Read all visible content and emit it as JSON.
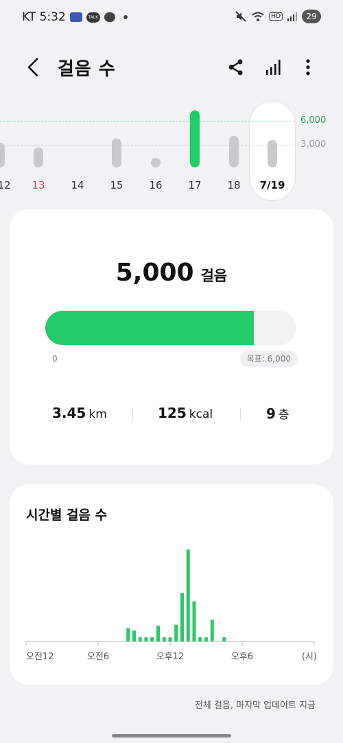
{
  "status_bar": {
    "carrier_time": "KT 5:32",
    "icons": [
      "app-icon",
      "kakao-talk-icon",
      "chat-bubble-icon",
      "dot-icon"
    ],
    "talk_label": "TALK",
    "hd_label": "HD",
    "battery": "29"
  },
  "header": {
    "title": "걸음 수",
    "back_icon": "chevron-left-icon",
    "share_icon": "share-icon",
    "chart_icon": "bar-chart-icon",
    "more_icon": "more-vertical-icon"
  },
  "daily_strip": {
    "goal_label": "6,000",
    "mid_label": "3,000",
    "days": [
      {
        "label": "12",
        "steps": 3000,
        "red": false,
        "selected": false
      },
      {
        "label": "13",
        "steps": 2400,
        "red": true,
        "selected": false
      },
      {
        "label": "14",
        "steps": 0,
        "red": false,
        "selected": false
      },
      {
        "label": "15",
        "steps": 3500,
        "red": false,
        "selected": false
      },
      {
        "label": "16",
        "steps": 1100,
        "red": false,
        "selected": false
      },
      {
        "label": "17",
        "steps": 6900,
        "red": false,
        "selected": false
      },
      {
        "label": "18",
        "steps": 3800,
        "red": false,
        "selected": false
      },
      {
        "label": "7/19",
        "steps": 3300,
        "red": false,
        "selected": true
      }
    ],
    "accent_color": "#23cc67",
    "bar_color": "#c9c9cb",
    "weekend_color": "#d34c3e"
  },
  "summary": {
    "steps": "5,000",
    "steps_unit": "걸음",
    "progress_fraction": 0.83,
    "progress_start": "0",
    "goal_text": "목표: 6,000",
    "distance": "3.45",
    "distance_unit": "km",
    "calories": "125",
    "calories_unit": "kcal",
    "floors": "9",
    "floors_unit": "층"
  },
  "hourly": {
    "title": "시간별 걸음 수",
    "x_tick_labels": [
      "오전12",
      "오전6",
      "오후12",
      "오후6"
    ],
    "x_unit": "(시)"
  },
  "chart_data": {
    "type": "bar",
    "title": "시간별 걸음 수",
    "xlabel": "(시)",
    "ylabel": "",
    "x_tick_labels": [
      "오전12",
      "오전6",
      "오후12",
      "오후6"
    ],
    "x_hours": [
      8.5,
      9.0,
      9.5,
      10.0,
      10.5,
      11.0,
      11.5,
      12.0,
      12.5,
      13.0,
      13.5,
      14.0,
      14.5,
      15.0,
      15.5,
      16.5
    ],
    "values": [
      160,
      130,
      50,
      50,
      50,
      190,
      50,
      50,
      200,
      580,
      1100,
      480,
      50,
      50,
      260,
      50
    ],
    "xlim": [
      0,
      24
    ],
    "grid": false,
    "color": "#23cc67"
  },
  "footer": {
    "note": "전체 걸음, 마지막 업데이트 지금"
  }
}
